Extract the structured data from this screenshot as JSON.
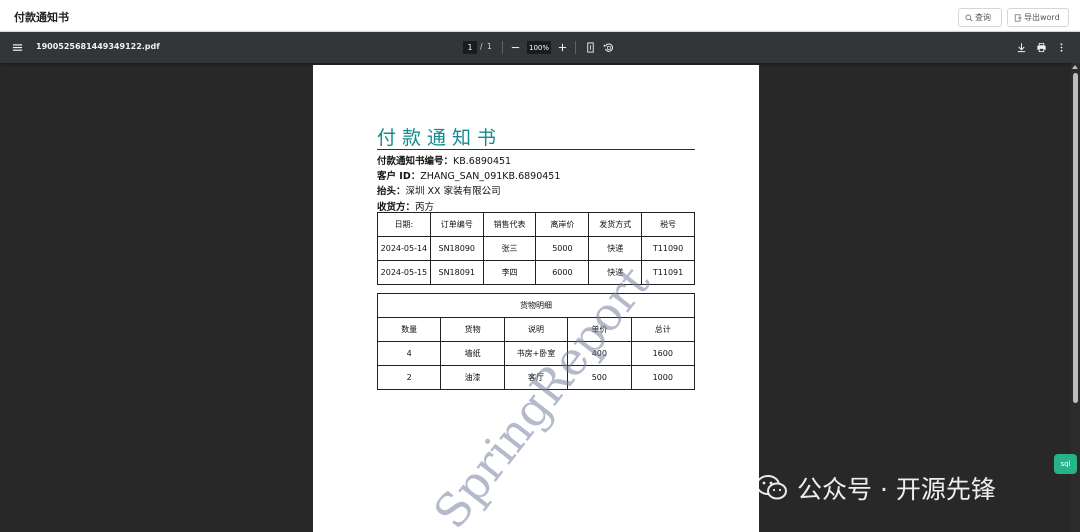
{
  "app": {
    "title": "付款通知书",
    "query_label": "查询",
    "export_label": "导出word"
  },
  "viewer": {
    "file_name": "1900525681449349122.pdf",
    "current_page": "1",
    "page_separator": "/",
    "total_pages": "1",
    "zoom": "100%"
  },
  "doc": {
    "title": "付款通知书",
    "fields": [
      {
        "label": "付款通知书编号：",
        "value": "KB.6890451"
      },
      {
        "label": "客户 ID：",
        "value": "ZHANG_SAN_091KB.6890451"
      },
      {
        "label": "抬头：",
        "value": "深圳 XX 家装有限公司"
      },
      {
        "label": "收货方：",
        "value": "丙方"
      }
    ],
    "orders": {
      "headers": [
        "日期:",
        "订单编号",
        "销售代表",
        "离岸价",
        "发货方式",
        "税号"
      ],
      "rows": [
        [
          "2024-05-14",
          "SN18090",
          "张三",
          "5000",
          "快递",
          "T11090"
        ],
        [
          "2024-05-15",
          "SN18091",
          "李四",
          "6000",
          "快递",
          "T11091"
        ]
      ]
    },
    "goods": {
      "caption": "货物明细",
      "headers": [
        "数量",
        "货物",
        "说明",
        "单价",
        "总计"
      ],
      "rows": [
        [
          "4",
          "墙纸",
          "书房+卧室",
          "400",
          "1600"
        ],
        [
          "2",
          "油漆",
          "客厅",
          "500",
          "1000"
        ]
      ]
    },
    "watermark": "SpringReport"
  },
  "float_button": "sql",
  "wechat_watermark": "公众号 · 开源先锋"
}
